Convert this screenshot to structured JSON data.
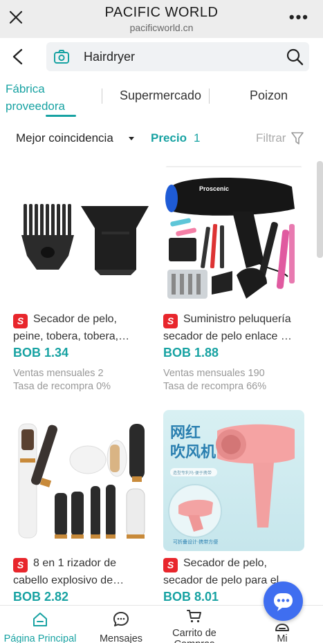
{
  "browser": {
    "title": "PACIFIC WORLD",
    "url": "pacificworld.cn"
  },
  "search": {
    "query": "Hairdryer"
  },
  "tabs": [
    {
      "label_line1": "Fábrica",
      "label_line2": "proveedora",
      "active": true
    },
    {
      "label": "Supermercado"
    },
    {
      "label": "Poizon"
    }
  ],
  "filters": {
    "sort_label": "Mejor coincidencia",
    "price_label": "Precio",
    "price_count": "1",
    "filter_label": "Filtrar"
  },
  "products": [
    {
      "badge": "S",
      "name_line1": "Secador de pelo,",
      "name_line2": "peine, tobera, tobera,…",
      "price": "BOB 1.34",
      "sales": "Ventas mensuales 2",
      "repurchase": "Tasa de recompra 0%"
    },
    {
      "badge": "S",
      "name_line1": "Suministro peluquería",
      "name_line2": "secador de pelo enlace …",
      "price": "BOB 1.88",
      "sales": "Ventas mensuales 190",
      "repurchase": "Tasa de recompra 66%",
      "image_brand_text": "Proscenic"
    },
    {
      "badge": "S",
      "name_line1": "8 en 1 rizador de",
      "name_line2": "cabello explosivo de…",
      "price": "BOB 2.82"
    },
    {
      "badge": "S",
      "name_line1": "Secador de pelo,",
      "name_line2": "secador de pelo para el…",
      "price": "BOB 8.01",
      "image_text_line1": "网红",
      "image_text_line2": "吹风机",
      "image_small_text": "造型专利马·便于携带",
      "image_bottom_text": "可折叠设计·携带方便"
    }
  ],
  "bottom_nav": [
    {
      "label": "Página Principal",
      "icon": "home-icon",
      "active": true
    },
    {
      "label": "Mensajes",
      "icon": "chat-icon"
    },
    {
      "label": "Carrito de Compras",
      "icon": "cart-icon"
    },
    {
      "label": "Mi",
      "icon": "user-icon"
    }
  ],
  "colors": {
    "accent": "#17a2a2",
    "badge": "#e8262c",
    "fab": "#3f6ef0"
  }
}
